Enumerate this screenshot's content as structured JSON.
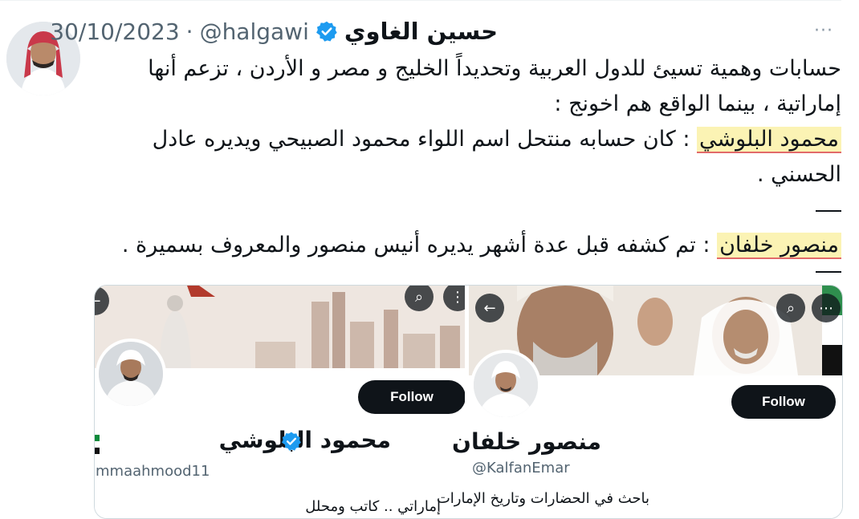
{
  "tweet": {
    "author": {
      "display_name": "حسين الغاوي",
      "handle": "@halgawi",
      "separator": "·",
      "date": "30/10/2023",
      "verified_icon": "verified-badge-icon"
    },
    "more_icon": "more-options-icon",
    "body": {
      "line1": "حسابات وهمية تسيئ للدول العربية وتحديداً الخليج و مصر و الأردن ، تزعم أنها",
      "line2": "إماراتية ، بينما الواقع هم اخونج :",
      "name1": "محمود البلوشي",
      "line3_rest": " : كان حسابه منتحل اسم اللواء محمود الصبيحي ويديره عادل",
      "line4": "الحسني .",
      "name2": "منصور خلفان",
      "line5_rest": " : تم كشفه قبل عدة أشهر يديره أنيس منصور والمعروف بسميرة ."
    },
    "highlight_color": "#fbf3b4",
    "underline_color": "#e26a6a"
  },
  "media": {
    "left_profile": {
      "name": "محمود البلوشي",
      "handle": "mmaahmood11",
      "follow_label": "Follow",
      "bio": "إماراتي .. كاتب ومحلل"
    },
    "right_profile": {
      "name": "منصور خلفان",
      "handle": "@KalfanEmar",
      "follow_label": "Follow",
      "bio": "باحث في الحضارات وتاريخ الإمارات"
    }
  }
}
